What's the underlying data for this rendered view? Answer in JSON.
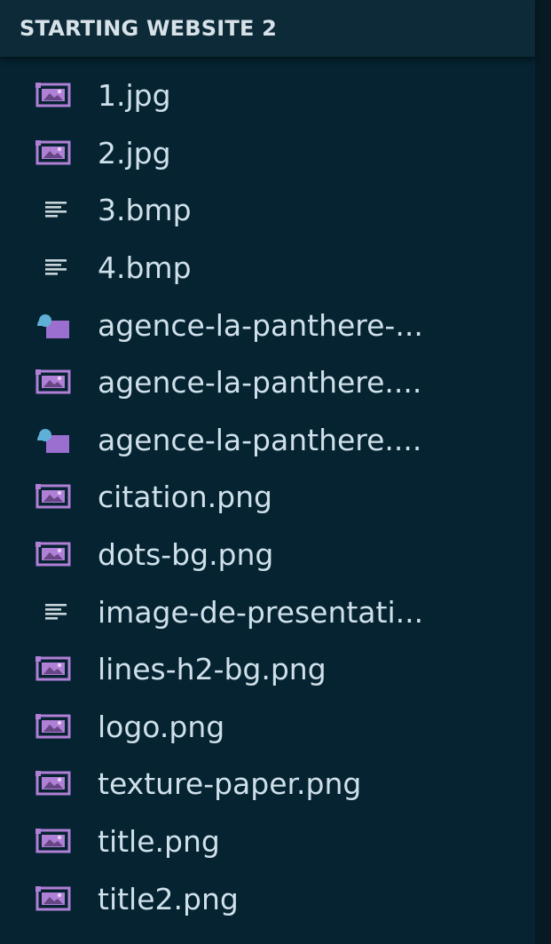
{
  "explorer": {
    "title": "STARTING WEBSITE 2",
    "files": [
      {
        "label": "1.jpg",
        "icon": "image-file-icon"
      },
      {
        "label": "2.jpg",
        "icon": "image-file-icon"
      },
      {
        "label": "3.bmp",
        "icon": "text-lines-icon"
      },
      {
        "label": "4.bmp",
        "icon": "text-lines-icon"
      },
      {
        "label": "agence-la-panthere-...",
        "icon": "shapes-file-icon"
      },
      {
        "label": "agence-la-panthere....",
        "icon": "image-file-icon"
      },
      {
        "label": "agence-la-panthere....",
        "icon": "shapes-file-icon"
      },
      {
        "label": "citation.png",
        "icon": "image-file-icon"
      },
      {
        "label": "dots-bg.png",
        "icon": "image-file-icon"
      },
      {
        "label": "image-de-presentati...",
        "icon": "text-lines-icon"
      },
      {
        "label": "lines-h2-bg.png",
        "icon": "image-file-icon"
      },
      {
        "label": "logo.png",
        "icon": "image-file-icon"
      },
      {
        "label": "texture-paper.png",
        "icon": "image-file-icon"
      },
      {
        "label": "title.png",
        "icon": "image-file-icon"
      },
      {
        "label": "title2.png",
        "icon": "image-file-icon"
      }
    ]
  },
  "colors": {
    "background": "#052330",
    "header": "#0d2a38",
    "text": "#cfe0ea",
    "image_icon": "#b07fd6",
    "text_icon": "#c9d4da",
    "shapes_icon_primary": "#9b6fd0",
    "shapes_icon_secondary": "#5fb0d6"
  }
}
